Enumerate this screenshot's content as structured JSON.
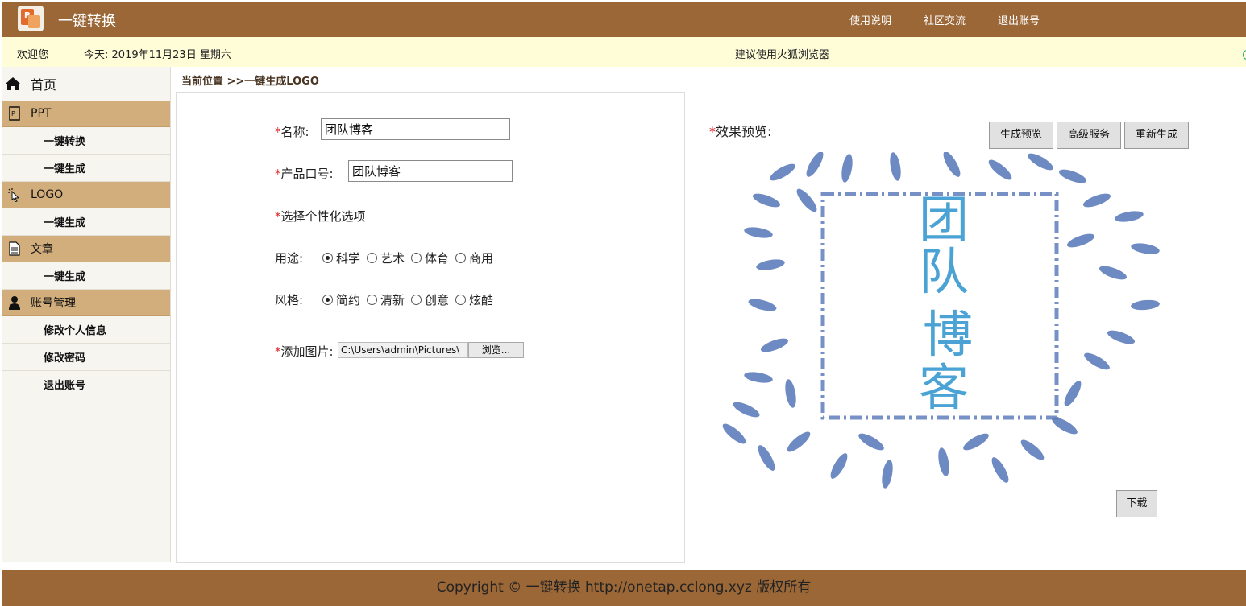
{
  "header": {
    "app_title": "一键转换",
    "links": [
      "使用说明",
      "社区交流",
      "退出账号"
    ],
    "colors": {
      "bar": "#9b6737"
    }
  },
  "infobar": {
    "welcome": "欢迎您",
    "today_label": "今天:",
    "today_value": "2019年11月23日 星期六",
    "tip": "建议使用火狐浏览器"
  },
  "sidebar": {
    "home": {
      "label": "首页",
      "icon": "home-icon"
    },
    "groups": [
      {
        "label": "PPT",
        "icon": "ppt-icon",
        "items": [
          "一键转换",
          "一键生成"
        ]
      },
      {
        "label": "LOGO",
        "icon": "cursor-icon",
        "items": [
          "一键生成"
        ]
      },
      {
        "label": "文章",
        "icon": "document-icon",
        "items": [
          "一键生成"
        ]
      },
      {
        "label": "账号管理",
        "icon": "user-icon",
        "items": [
          "修改个人信息",
          "修改密码",
          "退出账号"
        ]
      }
    ]
  },
  "breadcrumb": "当前位置 >>一键生成LOGO",
  "form": {
    "required_mark": "*",
    "name_label": "名称:",
    "name_value": "团队博客",
    "slogan_label": "产品口号:",
    "slogan_value": "团队博客",
    "options_label": "选择个性化选项",
    "usage_label": "用途:",
    "usage_options": [
      "科学",
      "艺术",
      "体育",
      "商用"
    ],
    "usage_selected": "科学",
    "style_label": "风格:",
    "style_options": [
      "简约",
      "清新",
      "创意",
      "炫酷"
    ],
    "style_selected": "简约",
    "image_label": "添加图片:",
    "image_path": "C:\\Users\\admin\\Pictures\\",
    "browse_label": "浏览..."
  },
  "preview": {
    "label": "效果预览:",
    "generate_button": "生成预览",
    "advanced_button": "高级服务",
    "regenerate_button": "重新生成",
    "download_button": "下载",
    "logo_text": [
      "团",
      "队",
      "博",
      "客"
    ],
    "colors": {
      "leaf": "#5576b8",
      "text": "#4aa3d4"
    }
  },
  "footer": "Copyright © 一键转换 http://onetap.cclong.xyz 版权所有"
}
